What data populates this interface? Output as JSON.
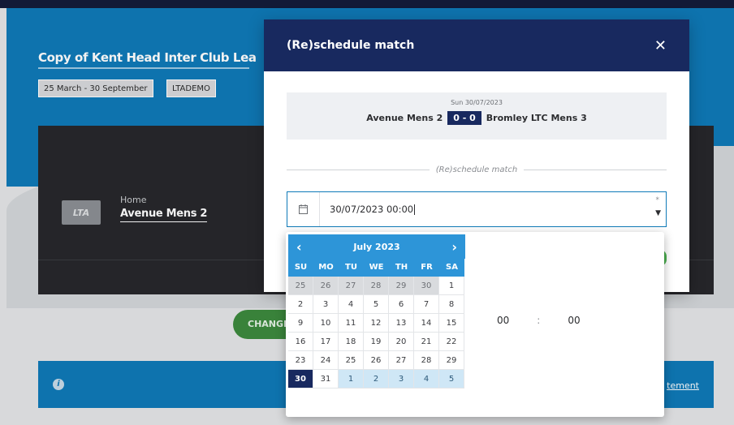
{
  "page": {
    "title": "Copy of Kent Head Inter Club Lea",
    "chips": [
      "25 March - 30 September",
      "LTADEMO"
    ],
    "home_label": "Home",
    "home_team": "Avenue Mens 2",
    "logo_text": "LTA",
    "change_button": "CHANGE",
    "info_link": "tement"
  },
  "modal": {
    "title": "(Re)schedule match",
    "close": "✕",
    "match": {
      "date": "Sun 30/07/2023",
      "home": "Avenue Mens 2",
      "score": "0 - 0",
      "away": "Bromley LTC Mens 3"
    },
    "section_label": "(Re)schedule match",
    "datetime_value": "30/07/2023 00:00",
    "required_mark": "*"
  },
  "datepicker": {
    "month_label": "July 2023",
    "prev": "‹",
    "next": "›",
    "weekdays": [
      "SU",
      "MO",
      "TU",
      "WE",
      "TH",
      "FR",
      "SA"
    ],
    "days": [
      {
        "d": "25",
        "t": "prev"
      },
      {
        "d": "26",
        "t": "prev"
      },
      {
        "d": "27",
        "t": "prev"
      },
      {
        "d": "28",
        "t": "prev"
      },
      {
        "d": "29",
        "t": "prev"
      },
      {
        "d": "30",
        "t": "prev"
      },
      {
        "d": "1",
        "t": "cur"
      },
      {
        "d": "2",
        "t": "cur"
      },
      {
        "d": "3",
        "t": "cur"
      },
      {
        "d": "4",
        "t": "cur"
      },
      {
        "d": "5",
        "t": "cur"
      },
      {
        "d": "6",
        "t": "cur"
      },
      {
        "d": "7",
        "t": "cur"
      },
      {
        "d": "8",
        "t": "cur"
      },
      {
        "d": "9",
        "t": "cur"
      },
      {
        "d": "10",
        "t": "cur"
      },
      {
        "d": "11",
        "t": "cur"
      },
      {
        "d": "12",
        "t": "cur"
      },
      {
        "d": "13",
        "t": "cur"
      },
      {
        "d": "14",
        "t": "cur"
      },
      {
        "d": "15",
        "t": "cur"
      },
      {
        "d": "16",
        "t": "cur"
      },
      {
        "d": "17",
        "t": "cur"
      },
      {
        "d": "18",
        "t": "cur"
      },
      {
        "d": "19",
        "t": "cur"
      },
      {
        "d": "20",
        "t": "cur"
      },
      {
        "d": "21",
        "t": "cur"
      },
      {
        "d": "22",
        "t": "cur"
      },
      {
        "d": "23",
        "t": "cur"
      },
      {
        "d": "24",
        "t": "cur"
      },
      {
        "d": "25",
        "t": "cur"
      },
      {
        "d": "26",
        "t": "cur"
      },
      {
        "d": "27",
        "t": "cur"
      },
      {
        "d": "28",
        "t": "cur"
      },
      {
        "d": "29",
        "t": "cur"
      },
      {
        "d": "30",
        "t": "sel"
      },
      {
        "d": "31",
        "t": "cur"
      },
      {
        "d": "1",
        "t": "next"
      },
      {
        "d": "2",
        "t": "next"
      },
      {
        "d": "3",
        "t": "next"
      },
      {
        "d": "4",
        "t": "next"
      },
      {
        "d": "5",
        "t": "next"
      }
    ],
    "hour": "00",
    "minute": "00",
    "separator": ":"
  },
  "colors": {
    "header_navy": "#18295f",
    "hero_blue": "#0f7ab8",
    "picker_blue": "#2d95d8",
    "green": "#3d8a3e"
  }
}
